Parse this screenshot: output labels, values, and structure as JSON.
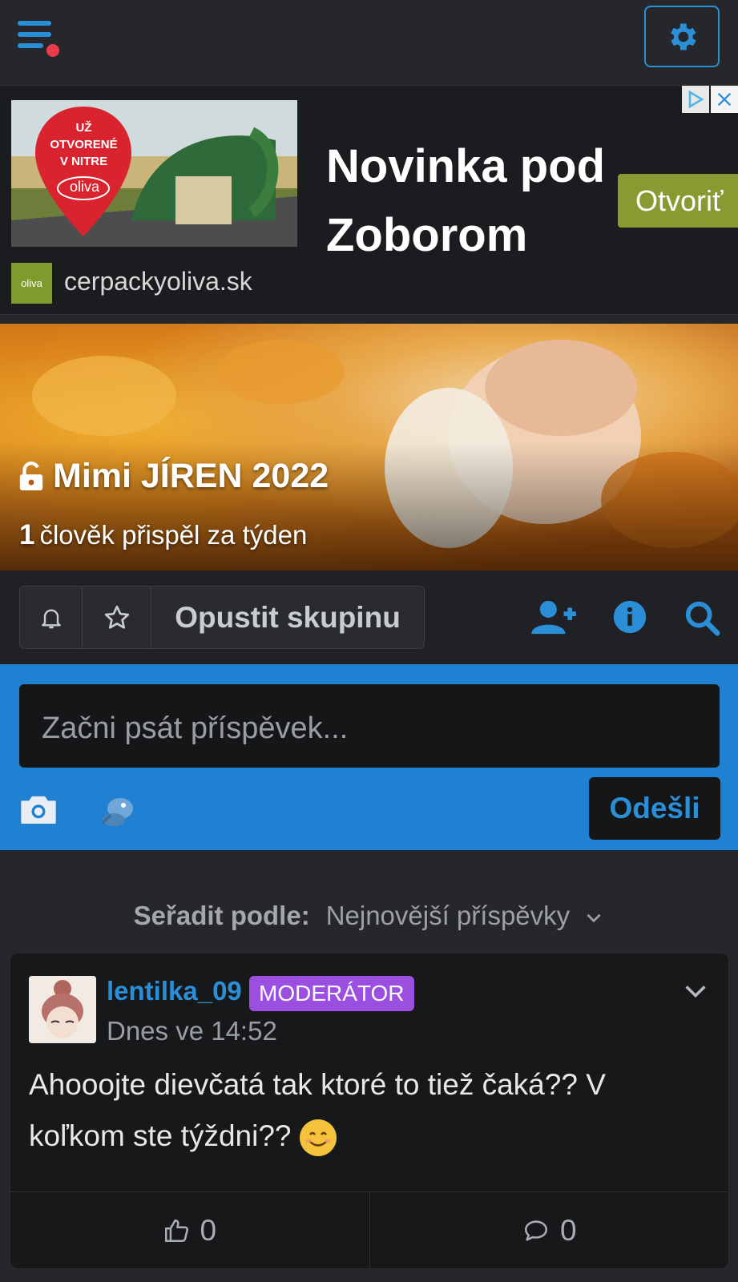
{
  "ad": {
    "badge_lines": [
      "UŽ",
      "OTVORENÉ",
      "V NITRE"
    ],
    "brand": "oliva",
    "logo_text": "oliva",
    "domain": "cerpackyoliva.sk",
    "headline": "Novinka pod Zoborom",
    "cta": "Otvoriť",
    "accent": "#8a9a32"
  },
  "group": {
    "title": "Mimi JÍREN 2022",
    "contrib_count": "1",
    "contrib_text": "člověk přispěl za týden"
  },
  "actions": {
    "leave_label": "Opustit skupinu"
  },
  "composer": {
    "placeholder": "Začni psát příspěvek...",
    "send_label": "Odešli"
  },
  "sort": {
    "label": "Seřadit podle:",
    "value": "Nejnovější příspěvky"
  },
  "post": {
    "author": "lentilka_09",
    "badge": "MODERÁTOR",
    "time": "Dnes ve 14:52",
    "text": "Ahooojte dievčatá tak ktoré to tiež čaká?? V koľkom ste týždni??",
    "likes": "0",
    "comments": "0"
  },
  "colors": {
    "accent": "#2b8fd8",
    "notification_dot": "#ec3c4b",
    "moderator_badge": "#9b4fe0",
    "composer_bg": "#2080d2"
  },
  "icons": [
    "menu-icon",
    "gear-icon",
    "ad-choices-icon",
    "close-icon",
    "lock-icon",
    "bell-icon",
    "star-icon",
    "add-user-icon",
    "info-icon",
    "search-icon",
    "camera-icon",
    "sticker-icon",
    "chevron-down-icon",
    "thumbs-up-icon",
    "comment-icon"
  ]
}
